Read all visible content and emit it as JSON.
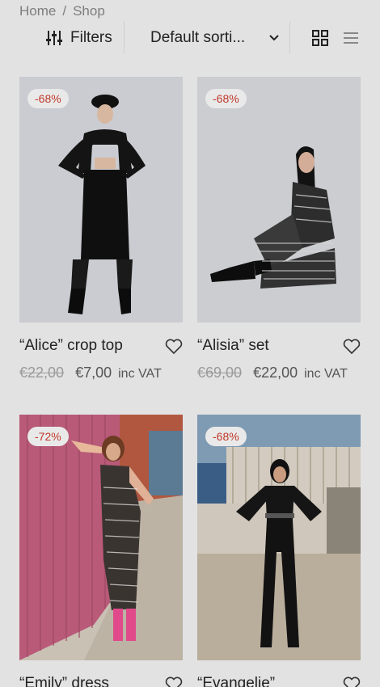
{
  "breadcrumb": {
    "home": "Home",
    "separator": "/",
    "current": "Shop"
  },
  "toolbar": {
    "filters_label": "Filters",
    "sort_label": "Default sorti...",
    "view_grid_icon": "grid-icon",
    "view_list_icon": "list-icon"
  },
  "products": [
    {
      "badge": "-68%",
      "title": "“Alice” crop top",
      "old_price": "€22,00",
      "new_price": "€7,00",
      "vat": "inc VAT"
    },
    {
      "badge": "-68%",
      "title": "“Alisia” set",
      "old_price": "€69,00",
      "new_price": "€22,00",
      "vat": "inc VAT"
    },
    {
      "badge": "-72%",
      "title": "“Emily” dress",
      "old_price": "",
      "new_price": "",
      "vat": ""
    },
    {
      "badge": "-68%",
      "title": "“Evangelie”",
      "old_price": "",
      "new_price": "",
      "vat": ""
    }
  ],
  "colors": {
    "background": "#e2e2e2",
    "badge_text": "#c0392b",
    "badge_bg": "#e9e9e9"
  }
}
